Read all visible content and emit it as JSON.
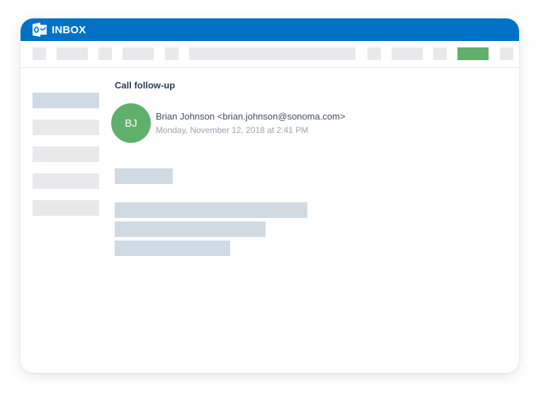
{
  "app": {
    "title": "INBOX",
    "logo_icon": "outlook-icon",
    "brand_color": "#0072c6"
  },
  "toolbar": {
    "placeholder_color": "#e8e9eb",
    "primary_action_color": "#5fb06b"
  },
  "sidebar": {
    "folder_count": 5,
    "selected_folder_color": "#cfdae3"
  },
  "message": {
    "subject": "Call follow-up",
    "avatar_initials": "BJ",
    "avatar_color": "#5fb06b",
    "sender": "Brian Johnson <brian.johnson@sonoma.com>",
    "date": "Monday, November 12, 2018 at 2:41 PM",
    "body_placeholder_color": "#cfdae3"
  }
}
